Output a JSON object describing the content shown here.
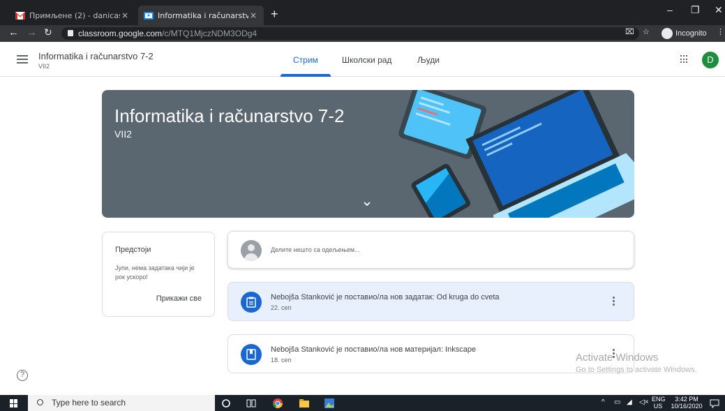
{
  "browser": {
    "tabs": [
      {
        "title": "Примљене (2) - danicastankovic",
        "active": false
      },
      {
        "title": "Informatika i računarstvo 7-2 VII2",
        "active": true
      }
    ],
    "url_host": "classroom.google.com",
    "url_path": "/c/MTQ1MjczNDM3ODg4",
    "incognito_label": "Incognito"
  },
  "app": {
    "class_name": "Informatika i računarstvo 7-2",
    "section": "VII2",
    "nav_tabs": [
      {
        "label": "Стрим",
        "active": true
      },
      {
        "label": "Школски рад",
        "active": false
      },
      {
        "label": "Људи",
        "active": false
      }
    ],
    "avatar_letter": "D",
    "accent_color": "#1967d2"
  },
  "banner": {
    "title": "Informatika i računarstvo 7-2",
    "subtitle": "VII2",
    "bg_color": "#5a6670"
  },
  "upcoming": {
    "title": "Предстоји",
    "body": "Јупи, нема задатака чији је рок ускоро!",
    "link": "Прикажи све"
  },
  "share": {
    "placeholder": "Делите нешто са одељењем..."
  },
  "posts": [
    {
      "title": "Nebojša Stanković је поставио/ла нов задатак: Od kruga do cveta",
      "date": "22. сеп",
      "icon": "assignment-icon"
    },
    {
      "title": "Nebojša Stanković је поставио/ла нов материјал: Inkscape",
      "date": "18. сеп",
      "icon": "material-icon"
    }
  ],
  "watermark": {
    "line1": "Activate Windows",
    "line2": "Go to Settings to activate Windows."
  },
  "taskbar": {
    "search_placeholder": "Type here to search",
    "lang_top": "ENG",
    "lang_bottom": "US",
    "time": "3:42 PM",
    "date": "10/16/2020"
  }
}
